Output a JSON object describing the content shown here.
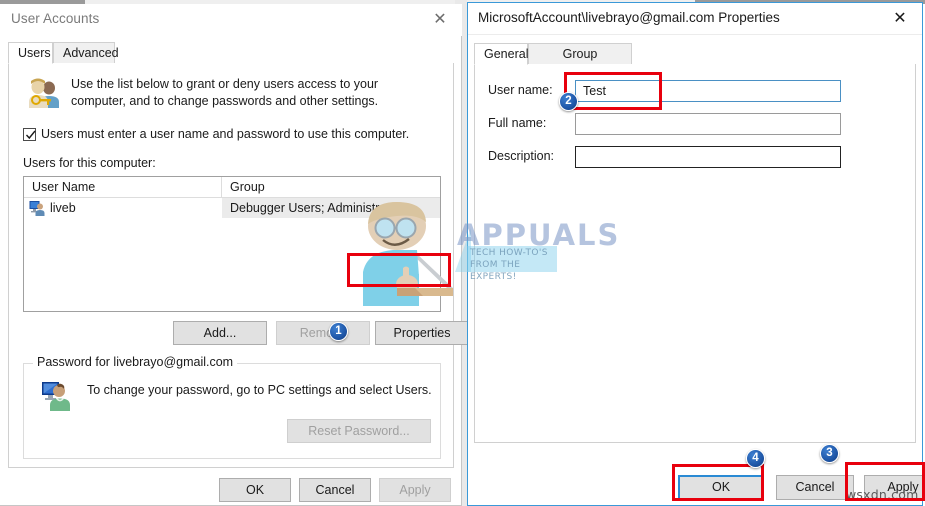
{
  "left_window": {
    "title": "User Accounts",
    "close_icon": "close-icon",
    "tabs": [
      {
        "label": "Users",
        "active": true
      },
      {
        "label": "Advanced",
        "active": false
      }
    ],
    "intro_text": "Use the list below to grant or deny users access to your computer, and to change passwords and other settings.",
    "checkbox": {
      "label": "Users must enter a user name and password to use this computer.",
      "checked": true
    },
    "list_label": "Users for this computer:",
    "list": {
      "columns": [
        "User Name",
        "Group"
      ],
      "rows": [
        {
          "user_name": "liveb",
          "group": "Debugger Users; Administrators"
        }
      ]
    },
    "buttons": {
      "add": "Add...",
      "remove": "Remove",
      "properties": "Properties"
    },
    "password_group": {
      "title": "Password for livebrayo@gmail.com",
      "text": "To change your password, go to PC settings and select Users.",
      "reset_button": "Reset Password..."
    },
    "footer": {
      "ok": "OK",
      "cancel": "Cancel",
      "apply": "Apply"
    }
  },
  "right_window": {
    "title": "MicrosoftAccount\\livebrayo@gmail.com Properties",
    "close_icon": "close-icon",
    "tabs": [
      {
        "label": "General",
        "active": true
      },
      {
        "label": "Group Membership",
        "active": false
      }
    ],
    "fields": [
      {
        "label": "User name:",
        "value": "Test",
        "placeholder": ""
      },
      {
        "label": "Full name:",
        "value": "",
        "placeholder": ""
      },
      {
        "label": "Description:",
        "value": "",
        "placeholder": ""
      }
    ],
    "footer": {
      "ok": "OK",
      "cancel": "Cancel",
      "apply": "Apply"
    }
  },
  "annotations": {
    "badges": [
      "1",
      "2",
      "3",
      "4"
    ],
    "highlight_color": "#e8000d",
    "badge_color": "#1f57a8"
  },
  "watermarks": {
    "brand": "APPUALS",
    "tagline": "TECH HOW-TO'S FROM THE EXPERTS!",
    "corner": "wsxdn.com"
  }
}
